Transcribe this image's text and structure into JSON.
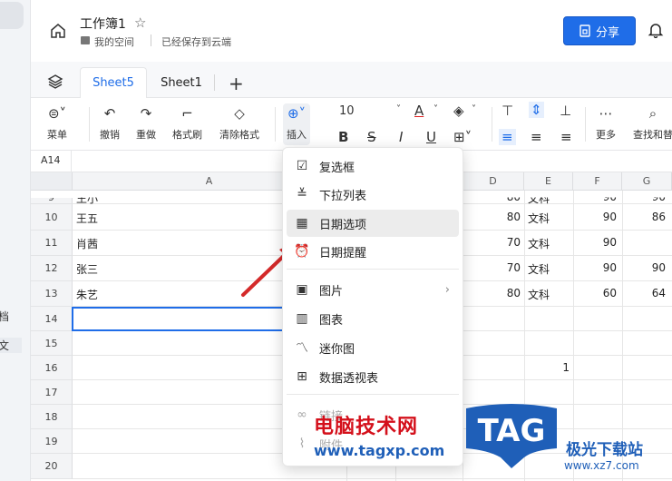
{
  "sidebar": {
    "item_1": "档",
    "item_2": "文"
  },
  "titlebar": {
    "doc_title": "工作簿1",
    "breadcrumb": "我的空间",
    "save_status": "已经保存到云端",
    "share_label": "分享"
  },
  "tabs": [
    {
      "label": "Sheet5",
      "active": true
    },
    {
      "label": "Sheet1",
      "active": false
    }
  ],
  "toolbar": {
    "menu": "菜单",
    "undo": "撤销",
    "redo": "重做",
    "format_painter": "格式刷",
    "clear_format": "清除格式",
    "insert": "插入",
    "font_size": "10",
    "more": "更多",
    "find_replace": "查找和替"
  },
  "cell_ref": "A14",
  "columns": [
    "A",
    "D",
    "E",
    "F",
    "G"
  ],
  "rows": [
    {
      "num": "9",
      "A": "王小",
      "D": "80",
      "E": "文科",
      "F": "90",
      "G": "90"
    },
    {
      "num": "10",
      "A": "王五",
      "D": "80",
      "E": "文科",
      "F": "90",
      "G": "86"
    },
    {
      "num": "11",
      "A": "肖茜",
      "D": "70",
      "E": "文科",
      "F": "90",
      "G": ""
    },
    {
      "num": "12",
      "A": "张三",
      "D": "70",
      "E": "文科",
      "F": "90",
      "G": "90"
    },
    {
      "num": "13",
      "A": "朱艺",
      "D": "80",
      "E": "文科",
      "F": "60",
      "G": "64"
    },
    {
      "num": "14",
      "A": "",
      "D": "",
      "E": "",
      "F": "",
      "G": ""
    },
    {
      "num": "15",
      "A": "",
      "D": "",
      "E": "",
      "F": "",
      "G": ""
    },
    {
      "num": "16",
      "A": "",
      "D": "",
      "E": "1",
      "F": "",
      "G": ""
    },
    {
      "num": "17",
      "A": "",
      "D": "",
      "E": "",
      "F": "",
      "G": ""
    },
    {
      "num": "18",
      "A": "",
      "D": "",
      "E": "",
      "F": "",
      "G": ""
    },
    {
      "num": "19",
      "A": "",
      "D": "",
      "E": "",
      "F": "",
      "G": ""
    },
    {
      "num": "20",
      "A": "",
      "D": "",
      "E": "",
      "F": "",
      "G": ""
    }
  ],
  "insert_menu": {
    "items": [
      {
        "label": "复选框",
        "icon": "checkbox-icon"
      },
      {
        "label": "下拉列表",
        "icon": "dropdown-list-icon"
      },
      {
        "label": "日期选项",
        "icon": "calendar-icon",
        "highlighted": true
      },
      {
        "label": "日期提醒",
        "icon": "alarm-icon"
      },
      {
        "label": "图片",
        "icon": "image-icon",
        "submenu": true
      },
      {
        "label": "图表",
        "icon": "chart-icon"
      },
      {
        "label": "迷你图",
        "icon": "sparkline-icon"
      },
      {
        "label": "数据透视表",
        "icon": "pivot-table-icon"
      },
      {
        "label": "链接",
        "icon": "link-icon"
      },
      {
        "label": "附件",
        "icon": "attachment-icon"
      }
    ]
  },
  "watermark": {
    "line1": "电脑技术网",
    "line2": "www.tagxp.com",
    "logo": "TAG",
    "site_name": "极光下载站",
    "site_url": "www.xz7.com"
  },
  "colors": {
    "accent": "#1f6de8",
    "arrow": "#d42a2a"
  }
}
